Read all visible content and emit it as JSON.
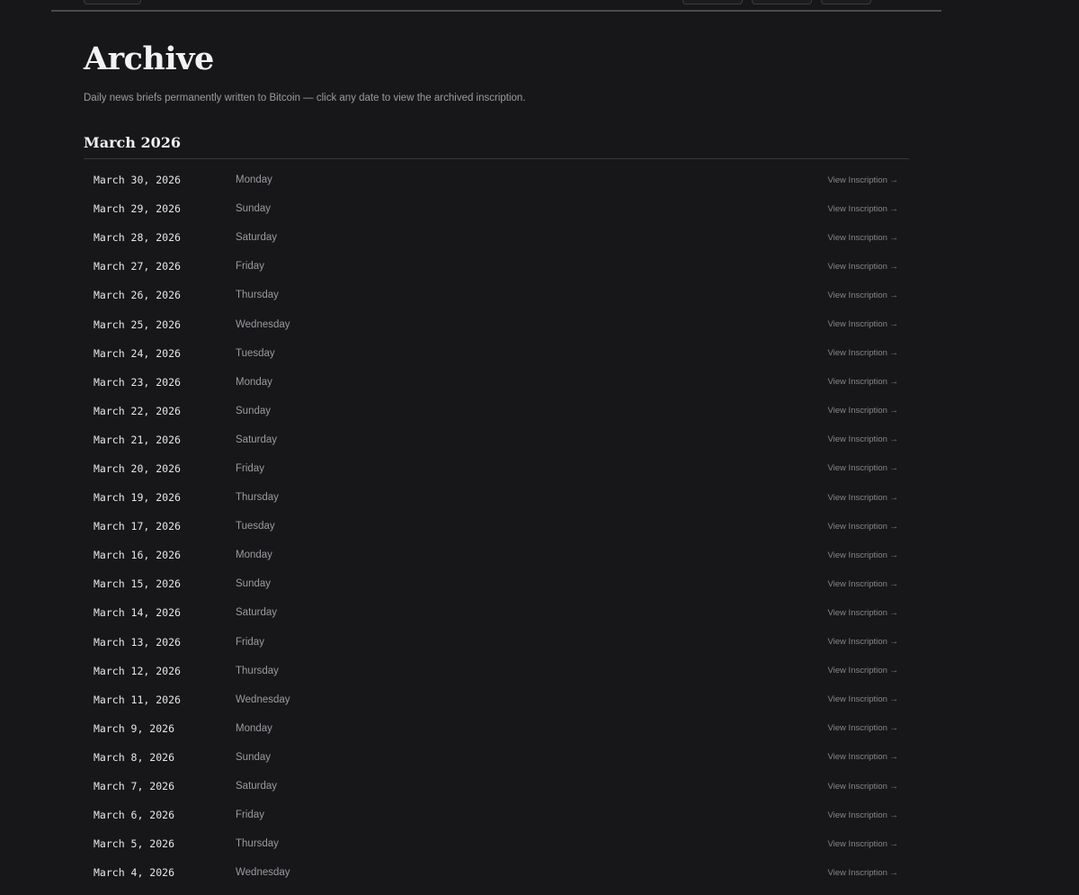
{
  "page": {
    "title": "Archive",
    "subtitle": "Daily news briefs permanently written to Bitcoin — click any date to view the archived inscription."
  },
  "section": {
    "heading": "March 2026",
    "link_label": "View Inscription →"
  },
  "entries": [
    {
      "date": "March 30, 2026",
      "day": "Monday"
    },
    {
      "date": "March 29, 2026",
      "day": "Sunday"
    },
    {
      "date": "March 28, 2026",
      "day": "Saturday"
    },
    {
      "date": "March 27, 2026",
      "day": "Friday"
    },
    {
      "date": "March 26, 2026",
      "day": "Thursday"
    },
    {
      "date": "March 25, 2026",
      "day": "Wednesday"
    },
    {
      "date": "March 24, 2026",
      "day": "Tuesday"
    },
    {
      "date": "March 23, 2026",
      "day": "Monday"
    },
    {
      "date": "March 22, 2026",
      "day": "Sunday"
    },
    {
      "date": "March 21, 2026",
      "day": "Saturday"
    },
    {
      "date": "March 20, 2026",
      "day": "Friday"
    },
    {
      "date": "March 19, 2026",
      "day": "Thursday"
    },
    {
      "date": "March 17, 2026",
      "day": "Tuesday"
    },
    {
      "date": "March 16, 2026",
      "day": "Monday"
    },
    {
      "date": "March 15, 2026",
      "day": "Sunday"
    },
    {
      "date": "March 14, 2026",
      "day": "Saturday"
    },
    {
      "date": "March 13, 2026",
      "day": "Friday"
    },
    {
      "date": "March 12, 2026",
      "day": "Thursday"
    },
    {
      "date": "March 11, 2026",
      "day": "Wednesday"
    },
    {
      "date": "March 9, 2026",
      "day": "Monday"
    },
    {
      "date": "March 8, 2026",
      "day": "Sunday"
    },
    {
      "date": "March 7, 2026",
      "day": "Saturday"
    },
    {
      "date": "March 6, 2026",
      "day": "Friday"
    },
    {
      "date": "March 5, 2026",
      "day": "Thursday"
    },
    {
      "date": "March 4, 2026",
      "day": "Wednesday"
    }
  ]
}
